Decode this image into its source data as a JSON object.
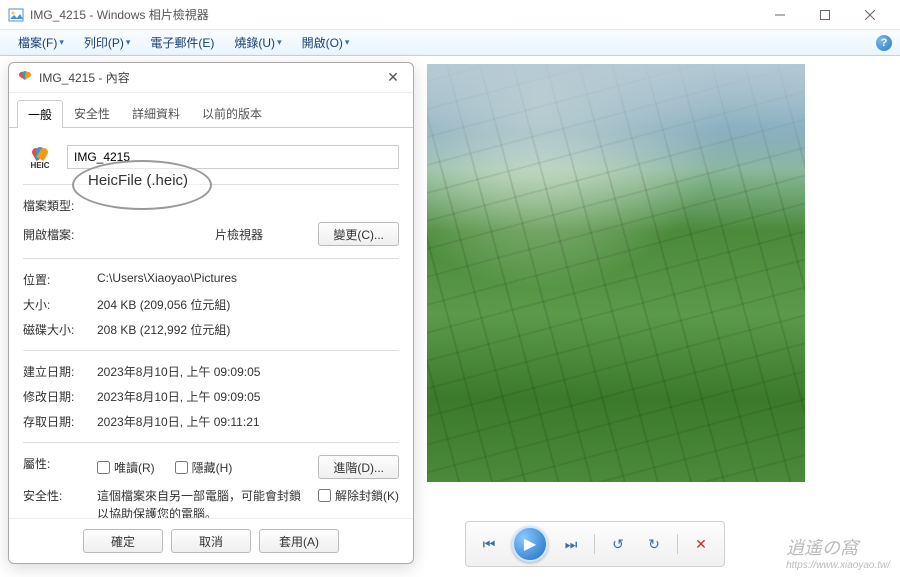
{
  "window": {
    "title": "IMG_4215 - Windows 相片檢視器"
  },
  "menubar": {
    "items": [
      {
        "label": "檔案(F)"
      },
      {
        "label": "列印(P)"
      },
      {
        "label": "電子郵件(E)"
      },
      {
        "label": "燒錄(U)"
      },
      {
        "label": "開啟(O)"
      }
    ]
  },
  "controlbar": {
    "prev": "⏮",
    "play": "▶",
    "next": "⏭",
    "rotate_ccw": "↺",
    "rotate_cw": "↻",
    "delete": "✕"
  },
  "dialog": {
    "title": "IMG_4215 - 內容",
    "tabs": [
      {
        "label": "一般",
        "active": true
      },
      {
        "label": "安全性"
      },
      {
        "label": "詳細資料"
      },
      {
        "label": "以前的版本"
      }
    ],
    "heic_label": "HEIC",
    "filename": "IMG_4215",
    "rows": {
      "filetype_label": "檔案類型:",
      "filetype_value": "HeicFile (.heic)",
      "openwith_label": "開啟檔案:",
      "openwith_value": "片檢視器",
      "change_btn": "變更(C)...",
      "location_label": "位置:",
      "location_value": "C:\\Users\\Xiaoyao\\Pictures",
      "size_label": "大小:",
      "size_value": "204 KB (209,056 位元組)",
      "disksize_label": "磁碟大小:",
      "disksize_value": "208 KB (212,992 位元組)",
      "created_label": "建立日期:",
      "created_value": "2023年8月10日, 上午 09:09:05",
      "modified_label": "修改日期:",
      "modified_value": "2023年8月10日, 上午 09:09:05",
      "accessed_label": "存取日期:",
      "accessed_value": "2023年8月10日, 上午 09:11:21",
      "attrs_label": "屬性:",
      "readonly": "唯讀(R)",
      "hidden": "隱藏(H)",
      "advanced_btn": "進階(D)...",
      "security_label": "安全性:",
      "security_text": "這個檔案來自另一部電腦，可能會封鎖以協助保護您的電腦。",
      "unblock": "解除封鎖(K)"
    },
    "footer": {
      "ok": "確定",
      "cancel": "取消",
      "apply": "套用(A)"
    }
  },
  "ellipse_text": "HeicFile (.heic)",
  "watermark": {
    "text": "逍遙の窩",
    "url": "https://www.xiaoyao.tw/"
  }
}
